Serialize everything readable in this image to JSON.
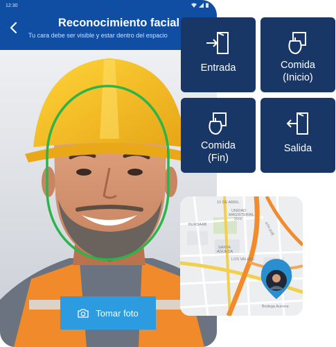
{
  "status_bar": {
    "time": "12:30"
  },
  "header": {
    "title": "Reconocimiento facial",
    "subtitle": "Tu cara debe ser visible y estar dentro del espacio"
  },
  "camera": {
    "take_photo_label": "Tomar foto"
  },
  "actions": [
    {
      "label_line1": "Entrada",
      "label_line2": "",
      "icon": "login-door-icon"
    },
    {
      "label_line1": "Comida",
      "label_line2": "(Inicio)",
      "icon": "food-cup-icon"
    },
    {
      "label_line1": "Comida",
      "label_line2": "(Fin)",
      "icon": "food-cup-icon"
    },
    {
      "label_line1": "Salida",
      "label_line2": "",
      "icon": "logout-door-icon"
    }
  ],
  "map": {
    "labels": {
      "avenue": "4TH AVE",
      "district_line1": "UNIDAD",
      "district_line2": "MAGISTERIAL",
      "district_line3": "2000",
      "top_number": "10 DE ABRIL",
      "burgaab": "BURSAAB",
      "santa_line1": "SANTA",
      "santa_line2": "AGUEDA",
      "los_valles": "LOS VALLES",
      "pin_caption": "Bodega Aurrera"
    }
  },
  "colors": {
    "header_blue": "#0f4ea2",
    "card_navy": "#183766",
    "button_blue": "#2d9be0",
    "face_guide_green": "#2ab44a",
    "map_pin": "#2a8fcf"
  }
}
